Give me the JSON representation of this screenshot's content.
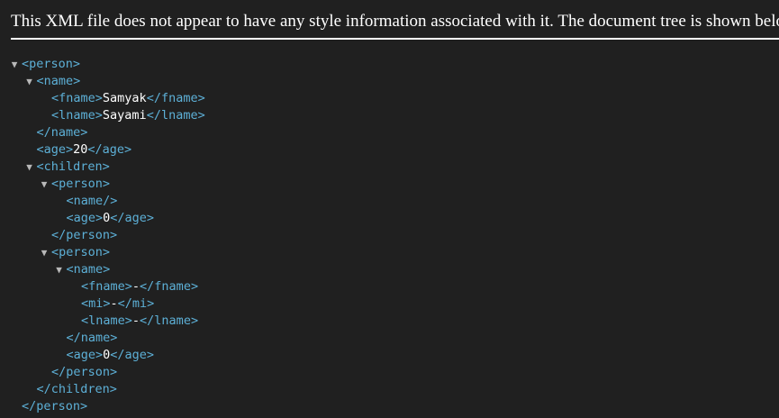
{
  "notice": "This XML file does not appear to have any style information associated with it. The document tree is shown below.",
  "icons": {
    "expanded": "triangle-down-icon",
    "glyph": "▼"
  },
  "colors": {
    "background": "#202020",
    "tag": "#5db0d7",
    "text": "#ffffff",
    "toggle": "#b8b8b8"
  },
  "tree": [
    {
      "depth": 0,
      "toggle": true,
      "tag": "<person>",
      "text": "",
      "close": ""
    },
    {
      "depth": 1,
      "toggle": true,
      "tag": "<name>",
      "text": "",
      "close": ""
    },
    {
      "depth": 2,
      "toggle": false,
      "tag": "<fname>",
      "text": "Samyak",
      "close": "</fname>"
    },
    {
      "depth": 2,
      "toggle": false,
      "tag": "<lname>",
      "text": "Sayami",
      "close": "</lname>"
    },
    {
      "depth": 1,
      "toggle": false,
      "tag": "</name>",
      "text": "",
      "close": ""
    },
    {
      "depth": 1,
      "toggle": false,
      "tag": "<age>",
      "text": "20",
      "close": "</age>"
    },
    {
      "depth": 1,
      "toggle": true,
      "tag": "<children>",
      "text": "",
      "close": ""
    },
    {
      "depth": 2,
      "toggle": true,
      "tag": "<person>",
      "text": "",
      "close": ""
    },
    {
      "depth": 3,
      "toggle": false,
      "tag": "<name/>",
      "text": "",
      "close": ""
    },
    {
      "depth": 3,
      "toggle": false,
      "tag": "<age>",
      "text": "0",
      "close": "</age>"
    },
    {
      "depth": 2,
      "toggle": false,
      "tag": "</person>",
      "text": "",
      "close": ""
    },
    {
      "depth": 2,
      "toggle": true,
      "tag": "<person>",
      "text": "",
      "close": ""
    },
    {
      "depth": 3,
      "toggle": true,
      "tag": "<name>",
      "text": "",
      "close": ""
    },
    {
      "depth": 4,
      "toggle": false,
      "tag": "<fname>",
      "text": "-",
      "close": "</fname>"
    },
    {
      "depth": 4,
      "toggle": false,
      "tag": "<mi>",
      "text": "-",
      "close": "</mi>"
    },
    {
      "depth": 4,
      "toggle": false,
      "tag": "<lname>",
      "text": "-",
      "close": "</lname>"
    },
    {
      "depth": 3,
      "toggle": false,
      "tag": "</name>",
      "text": "",
      "close": ""
    },
    {
      "depth": 3,
      "toggle": false,
      "tag": "<age>",
      "text": "0",
      "close": "</age>"
    },
    {
      "depth": 2,
      "toggle": false,
      "tag": "</person>",
      "text": "",
      "close": ""
    },
    {
      "depth": 1,
      "toggle": false,
      "tag": "</children>",
      "text": "",
      "close": ""
    },
    {
      "depth": 0,
      "toggle": false,
      "tag": "</person>",
      "text": "",
      "close": ""
    }
  ]
}
